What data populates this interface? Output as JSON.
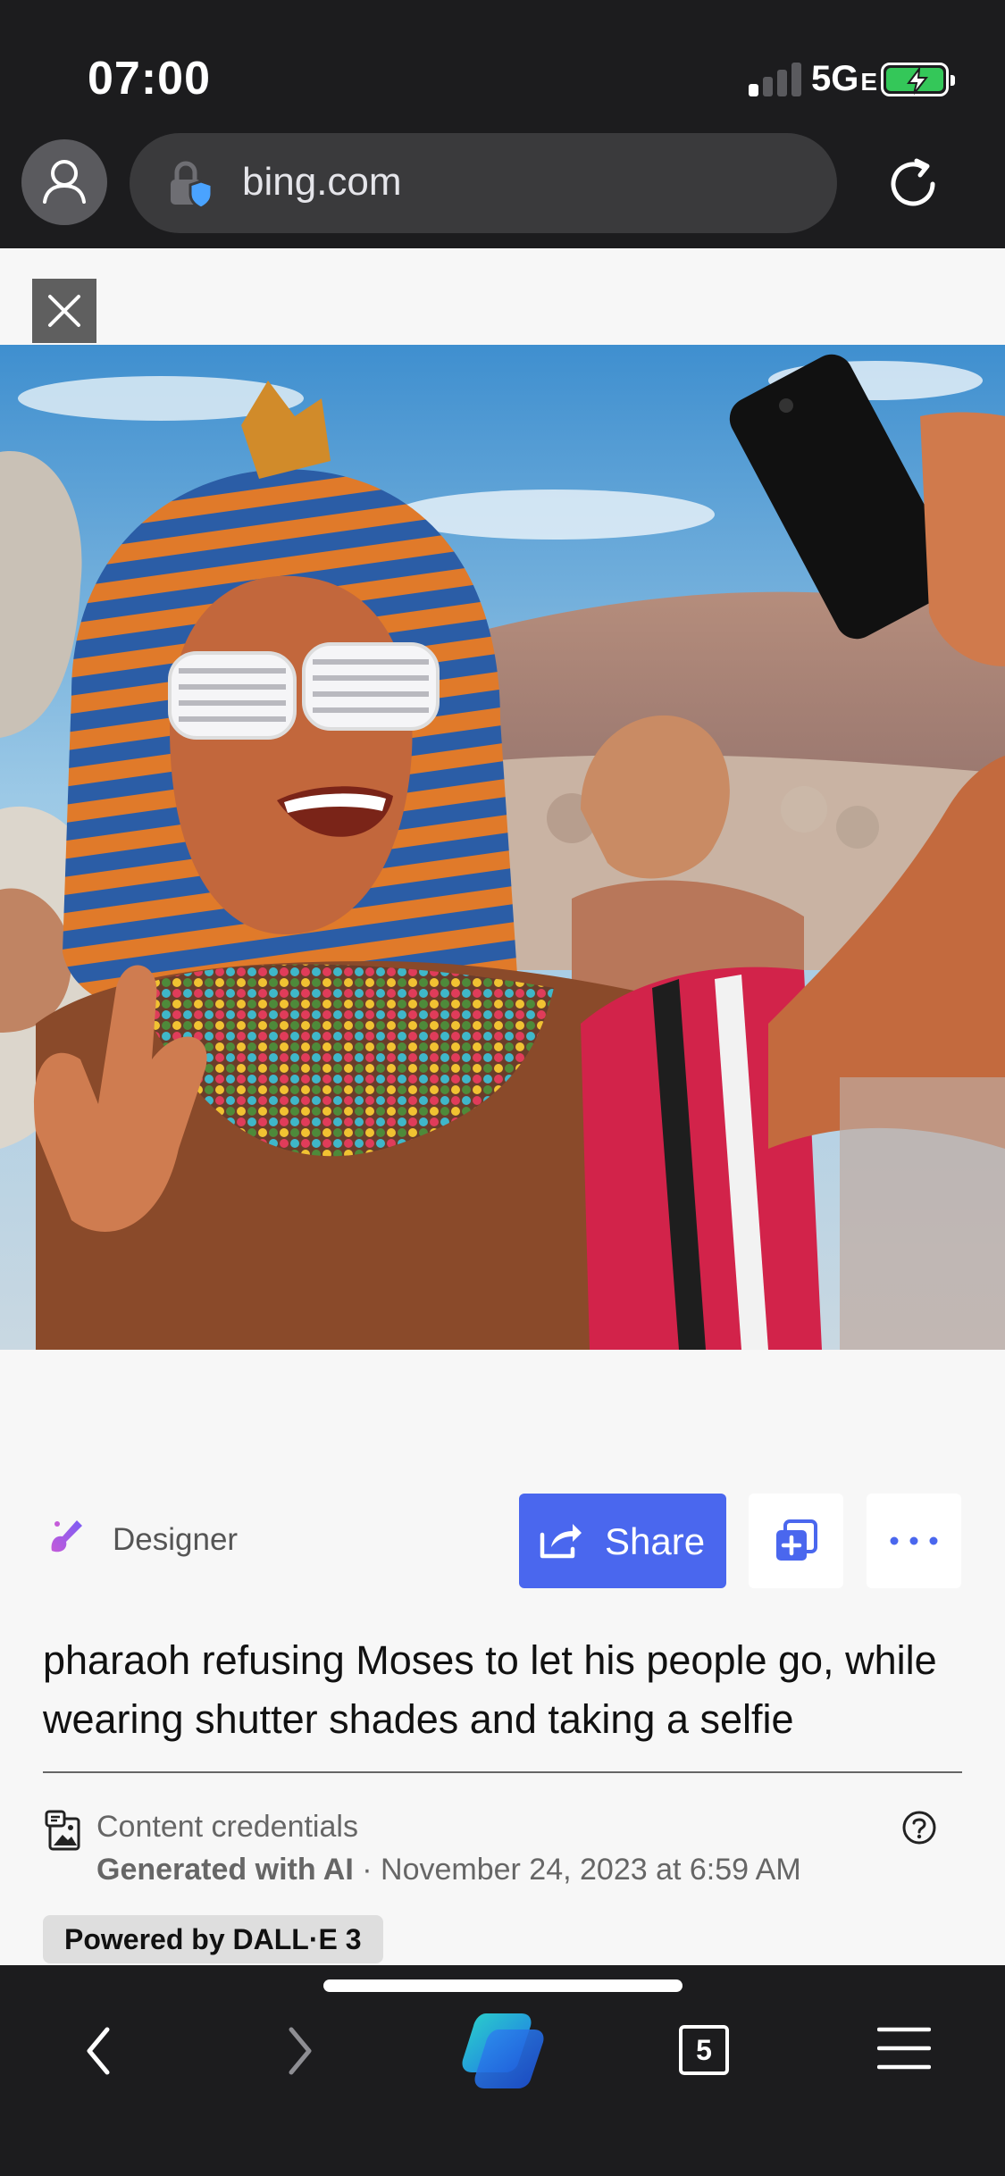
{
  "status_bar": {
    "time": "07:00",
    "network": "5G",
    "network_suffix": "E",
    "signal_bars_on": 1,
    "signal_bars_total": 4,
    "battery_charging": true,
    "battery_color": "#34c759"
  },
  "browser": {
    "url": "bing.com",
    "profile_icon": "person-icon",
    "lock_icon": "lock-shield-icon",
    "reload_icon": "reload-icon"
  },
  "image_viewer": {
    "close_icon": "close-icon",
    "image_description": "Illustration: pharaoh in striped nemes headdress and white shutter shades taking a selfie, bearded elders and crowd behind, desert hills"
  },
  "actions": {
    "source_label": "Designer",
    "share_label": "Share",
    "collection_icon": "add-to-collection-icon",
    "more_icon": "more-icon",
    "accent_color": "#4a67ee"
  },
  "prompt": "pharaoh refusing Moses to let his people go, while wearing shutter shades and taking a selfie",
  "credentials": {
    "title": "Content credentials",
    "generated": "Generated with AI",
    "separator": " · ",
    "date": "November 24, 2023 at 6:59 AM",
    "powered_by": "Powered by DALL·E 3"
  },
  "toolbar": {
    "tab_count": "5",
    "back_icon": "back-icon",
    "forward_icon": "forward-icon",
    "copilot_icon": "copilot-icon",
    "menu_icon": "menu-icon"
  }
}
